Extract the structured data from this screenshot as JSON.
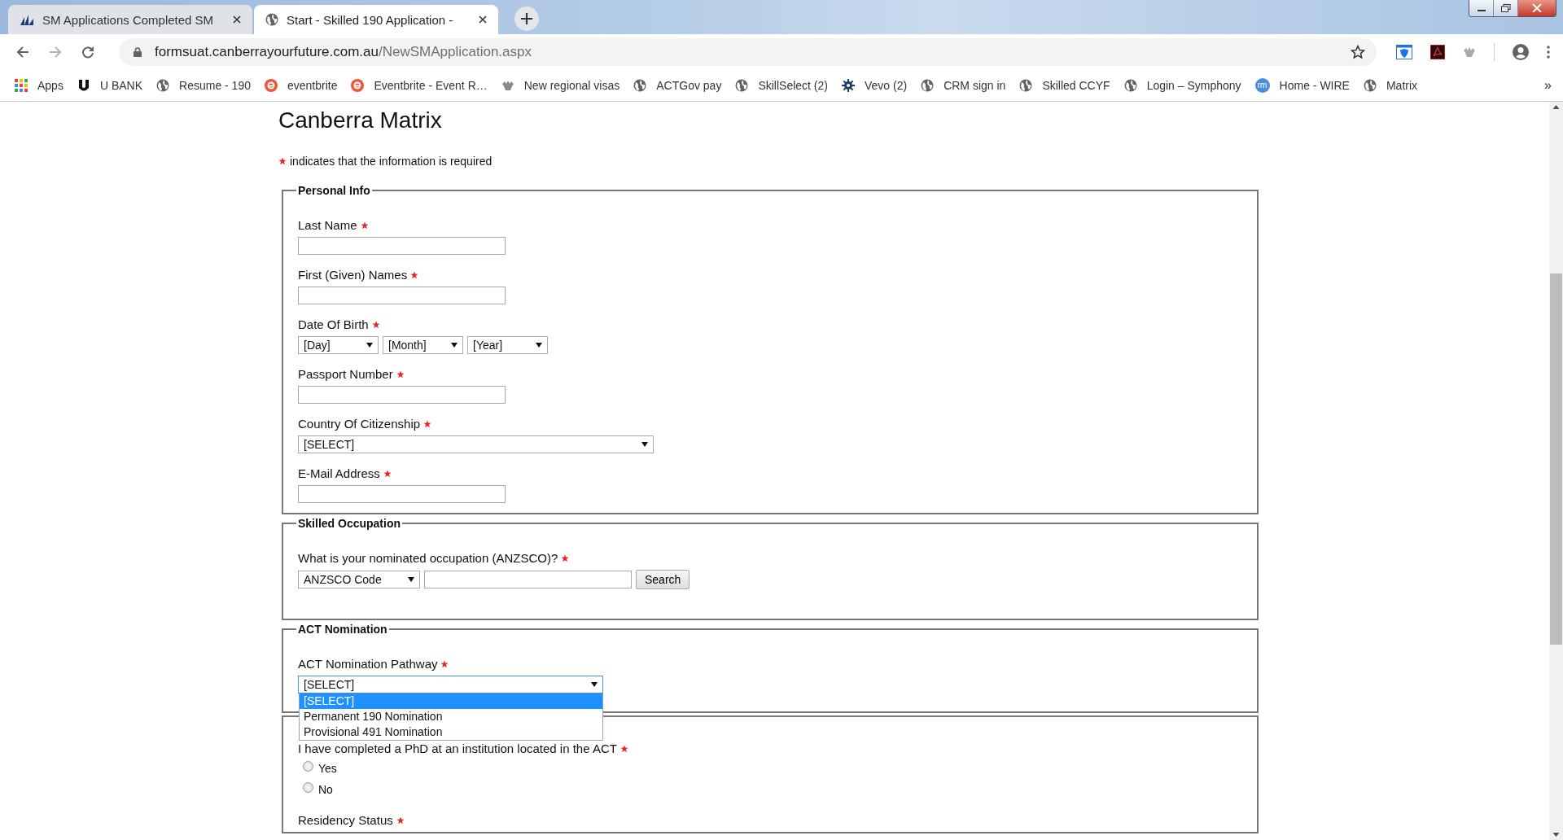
{
  "browser": {
    "tabs": [
      {
        "title": "SM Applications Completed SM",
        "selected": false
      },
      {
        "title": "Start - Skilled 190 Application -",
        "selected": true
      }
    ],
    "address": {
      "host": "formsuat.canberrayourfuture.com.au",
      "path": "/NewSMApplication.aspx"
    },
    "bookmarks": [
      {
        "label": "Apps"
      },
      {
        "label": "U BANK"
      },
      {
        "label": "Resume - 190"
      },
      {
        "label": "eventbrite"
      },
      {
        "label": "Eventbrite - Event R…"
      },
      {
        "label": "New regional visas"
      },
      {
        "label": "ACTGov pay"
      },
      {
        "label": "SkillSelect (2)"
      },
      {
        "label": "Vevo (2)"
      },
      {
        "label": "CRM sign in"
      },
      {
        "label": "Skilled CCYF"
      },
      {
        "label": "Login – Symphony"
      },
      {
        "label": "Home - WIRE",
        "badge": "rm"
      },
      {
        "label": "Matrix"
      }
    ],
    "bookmarks_overflow": "»"
  },
  "page": {
    "title": "Canberra Matrix",
    "required_note": "indicates that the information is required",
    "sections": [
      {
        "legend": "Personal Info",
        "fields": [
          {
            "kind": "text",
            "label": "Last Name",
            "required": true
          },
          {
            "kind": "text",
            "label": "First (Given) Names",
            "required": true
          },
          {
            "kind": "date",
            "label": "Date Of Birth",
            "required": true,
            "selects": [
              "[Day]",
              "[Month]",
              "[Year]"
            ]
          },
          {
            "kind": "text",
            "label": "Passport Number",
            "required": true
          },
          {
            "kind": "select",
            "label": "Country Of Citizenship",
            "required": true,
            "value": "[SELECT]"
          },
          {
            "kind": "text",
            "label": "E-Mail Address",
            "required": true
          }
        ]
      },
      {
        "legend": "Skilled Occupation",
        "fields": [
          {
            "kind": "search",
            "label": "What is your nominated occupation (ANZSCO)?",
            "required": true,
            "select": "ANZSCO Code",
            "button": "Search"
          }
        ]
      },
      {
        "legend": "ACT Nomination",
        "fields": [
          {
            "kind": "select",
            "label": "ACT Nomination Pathway",
            "required": true,
            "value": "[SELECT]",
            "options": [
              {
                "label": "[SELECT]",
                "selected": true
              },
              {
                "label": "Permanent 190 Nomination",
                "selected": false
              },
              {
                "label": "Provisional 491 Nomination",
                "selected": false
              }
            ]
          }
        ]
      },
      {
        "fields": [
          {
            "kind": "radio",
            "label": "I have completed a PhD at an institution located in the ACT",
            "required": true,
            "options": [
              {
                "label": "Yes",
                "checked": false
              },
              {
                "label": "No",
                "checked": false
              }
            ]
          },
          {
            "kind": "radio",
            "label": "Residency Status",
            "required": true
          }
        ]
      }
    ]
  }
}
